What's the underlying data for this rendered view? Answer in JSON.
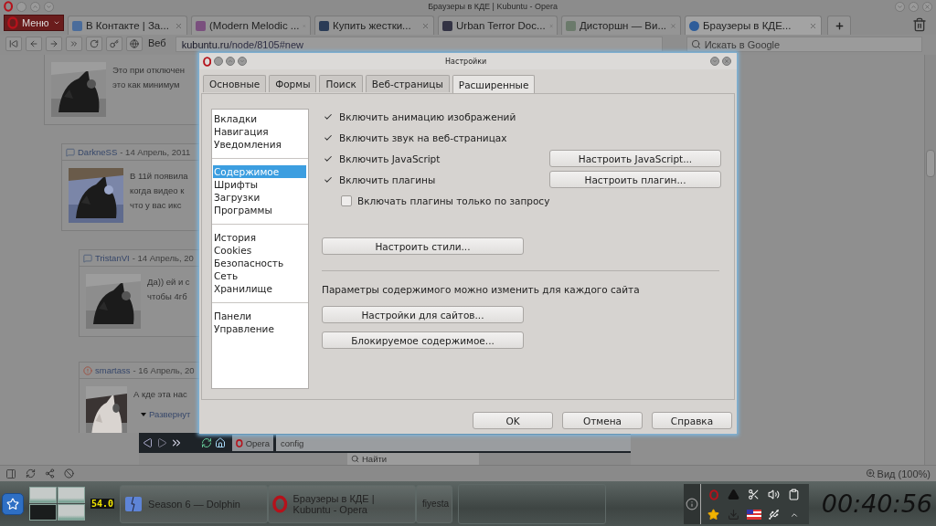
{
  "browser": {
    "title": "Браузеры в КДЕ | Kubuntu - Opera",
    "menu_label": "Меню",
    "tabs": [
      {
        "label": "В Контакте | За...",
        "selected": false
      },
      {
        "label": "(Modern Melodic ...",
        "selected": false
      },
      {
        "label": "Купить жестки...",
        "selected": false
      },
      {
        "label": "Urban Terror Doc...",
        "selected": false
      },
      {
        "label": "Дисторшн — Ви...",
        "selected": false
      },
      {
        "label": "Браузеры в КДЕ...",
        "selected": true
      }
    ],
    "nav": {
      "mode_label": "Веб",
      "address_host": "kubuntu.ru",
      "address_path": "/node/8105#new",
      "search_placeholder": "Искать в Google"
    },
    "comments": [
      {
        "lines": [
          "Это при отключен",
          "это как минимум"
        ]
      },
      {
        "author": "DarkneSS",
        "date": "- 14 Апрель, 2011",
        "kind": "bubble",
        "lines": [
          "В 11й появила",
          "когда видео к",
          "что у вас икс"
        ]
      },
      {
        "author": "TristanVI",
        "date": "- 14 Апрель, 20",
        "kind": "bubble",
        "lines": [
          "Да)) ей и с",
          "чтобы 4гб"
        ]
      },
      {
        "author": "smartass",
        "date": "- 16 Апрель, 20",
        "kind": "alert",
        "lines": [
          "А кде эта нас"
        ],
        "expander": "Развернут"
      }
    ],
    "embedded": {
      "tab": "Opera",
      "address": "config",
      "search_placeholder": "Найти"
    },
    "status": {
      "zoom": "Вид (100%)"
    }
  },
  "dialog": {
    "title": "Настройки",
    "tabs": [
      {
        "label": "Основные",
        "selected": false
      },
      {
        "label": "Формы",
        "selected": false
      },
      {
        "label": "Поиск",
        "selected": false
      },
      {
        "label": "Веб-страницы",
        "selected": false
      },
      {
        "label": "Расширенные",
        "selected": true
      }
    ],
    "categories": [
      {
        "items": [
          {
            "label": "Вкладки",
            "selected": false
          },
          {
            "label": "Навигация",
            "selected": false
          },
          {
            "label": "Уведомления",
            "selected": false
          }
        ]
      },
      {
        "items": [
          {
            "label": "Содержимое",
            "selected": true
          },
          {
            "label": "Шрифты",
            "selected": false
          },
          {
            "label": "Загрузки",
            "selected": false
          },
          {
            "label": "Программы",
            "selected": false
          }
        ]
      },
      {
        "items": [
          {
            "label": "История",
            "selected": false
          },
          {
            "label": "Cookies",
            "selected": false
          },
          {
            "label": "Безопасность",
            "selected": false
          },
          {
            "label": "Сеть",
            "selected": false
          },
          {
            "label": "Хранилище",
            "selected": false
          }
        ]
      },
      {
        "items": [
          {
            "label": "Панели",
            "selected": false
          },
          {
            "label": "Управление",
            "selected": false
          }
        ]
      }
    ],
    "options": [
      {
        "label": "Включить анимацию изображений",
        "checked": true
      },
      {
        "label": "Включить звук на веб-страницах",
        "checked": true
      },
      {
        "label": "Включить JavaScript",
        "checked": true,
        "button": "Настроить JavaScript..."
      },
      {
        "label": "Включить плагины",
        "checked": true,
        "button": "Настроить плагин...",
        "children": [
          {
            "label": "Включать плагины только по запросу",
            "checked": false
          }
        ]
      }
    ],
    "styles_button": "Настроить стили...",
    "site_note": "Параметры содержимого можно изменить для каждого сайта",
    "site_buttons": [
      "Настройки для сайтов...",
      "Блокируемое содержимое..."
    ],
    "footer_buttons": [
      "OK",
      "Отмена",
      "Справка"
    ]
  },
  "taskbar": {
    "pager": [
      {
        "selected": false
      },
      {
        "selected": false
      },
      {
        "selected": true
      },
      {
        "selected": false
      }
    ],
    "cpu": "54.0",
    "tasks": [
      {
        "label": "Season 6 — Dolphin",
        "kind": "files"
      },
      {
        "label": "Браузеры в КДЕ | Kubuntu - Opera",
        "kind": "browser"
      },
      {
        "label": "fiyesta",
        "kind": "chat"
      }
    ],
    "clock": "00:40:56"
  }
}
